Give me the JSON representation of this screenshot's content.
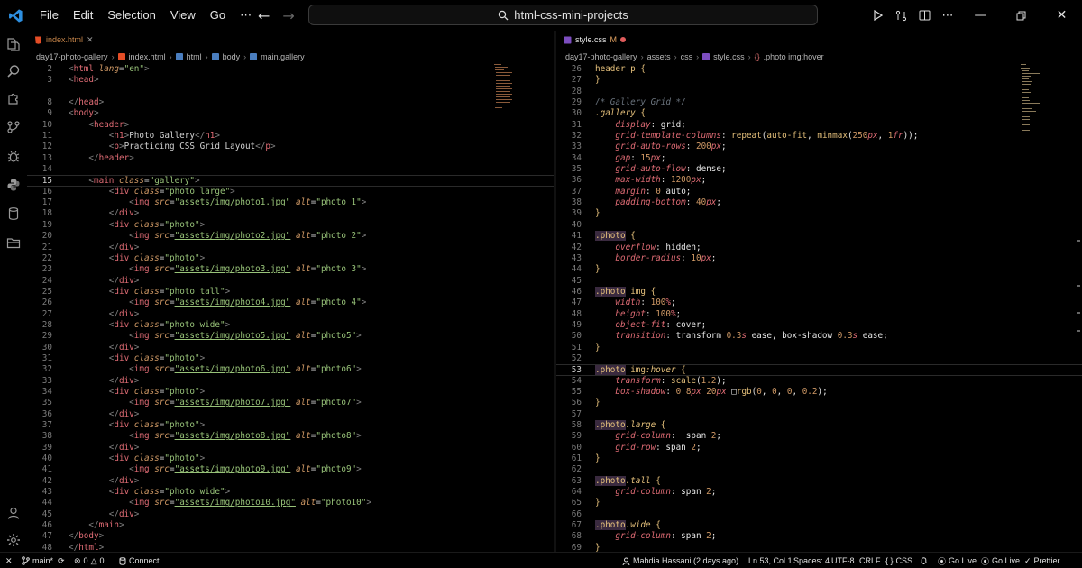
{
  "menu": [
    "File",
    "Edit",
    "Selection",
    "View",
    "Go"
  ],
  "titlebar": {
    "search": "html-css-mini-projects"
  },
  "left": {
    "tab": "index.html",
    "breadcrumb": [
      "day17-photo-gallery",
      "index.html",
      "html",
      "body",
      "main.gallery"
    ],
    "lines": [
      {
        "n": "2",
        "t": "<html lang=\"en\">"
      },
      {
        "n": "3",
        "t": "<head>"
      },
      {
        "n": "",
        "t": "    "
      },
      {
        "n": "8",
        "t": "</head>"
      },
      {
        "n": "9",
        "t": "<body>"
      },
      {
        "n": "10",
        "t": "    <header>"
      },
      {
        "n": "11",
        "t": "        <h1>Photo Gallery</h1>"
      },
      {
        "n": "12",
        "t": "        <p>Practicing CSS Grid Layout</p>"
      },
      {
        "n": "13",
        "t": "    </header>"
      },
      {
        "n": "14",
        "t": ""
      },
      {
        "n": "15",
        "t": "    <main class=\"gallery\">"
      },
      {
        "n": "16",
        "t": "        <div class=\"photo large\">"
      },
      {
        "n": "17",
        "t": "            <img src=\"assets/img/photo1.jpg\" alt=\"photo 1\">"
      },
      {
        "n": "18",
        "t": "        </div>"
      },
      {
        "n": "19",
        "t": "        <div class=\"photo\">"
      },
      {
        "n": "20",
        "t": "            <img src=\"assets/img/photo2.jpg\" alt=\"photo 2\">"
      },
      {
        "n": "21",
        "t": "        </div>"
      },
      {
        "n": "22",
        "t": "        <div class=\"photo\">"
      },
      {
        "n": "23",
        "t": "            <img src=\"assets/img/photo3.jpg\" alt=\"photo 3\">"
      },
      {
        "n": "24",
        "t": "        </div>"
      },
      {
        "n": "25",
        "t": "        <div class=\"photo tall\">"
      },
      {
        "n": "26",
        "t": "            <img src=\"assets/img/photo4.jpg\" alt=\"photo 4\">"
      },
      {
        "n": "27",
        "t": "        </div>"
      },
      {
        "n": "28",
        "t": "        <div class=\"photo wide\">"
      },
      {
        "n": "29",
        "t": "            <img src=\"assets/img/photo5.jpg\" alt=\"photo5\">"
      },
      {
        "n": "30",
        "t": "        </div>"
      },
      {
        "n": "31",
        "t": "        <div class=\"photo\">"
      },
      {
        "n": "32",
        "t": "            <img src=\"assets/img/photo6.jpg\" alt=\"photo6\">"
      },
      {
        "n": "33",
        "t": "        </div>"
      },
      {
        "n": "34",
        "t": "        <div class=\"photo\">"
      },
      {
        "n": "35",
        "t": "            <img src=\"assets/img/photo7.jpg\" alt=\"photo7\">"
      },
      {
        "n": "36",
        "t": "        </div>"
      },
      {
        "n": "37",
        "t": "        <div class=\"photo\">"
      },
      {
        "n": "38",
        "t": "            <img src=\"assets/img/photo8.jpg\" alt=\"photo8\">"
      },
      {
        "n": "39",
        "t": "        </div>"
      },
      {
        "n": "40",
        "t": "        <div class=\"photo\">"
      },
      {
        "n": "41",
        "t": "            <img src=\"assets/img/photo9.jpg\" alt=\"photo9\">"
      },
      {
        "n": "42",
        "t": "        </div>"
      },
      {
        "n": "43",
        "t": "        <div class=\"photo wide\">"
      },
      {
        "n": "44",
        "t": "            <img src=\"assets/img/photo10.jpg\" alt=\"photo10\">"
      },
      {
        "n": "45",
        "t": "        </div>"
      },
      {
        "n": "46",
        "t": "    </main>"
      },
      {
        "n": "47",
        "t": "</body>"
      },
      {
        "n": "48",
        "t": "</html>"
      }
    ]
  },
  "right": {
    "tab": "style.css",
    "tab_status": "M",
    "breadcrumb": [
      "day17-photo-gallery",
      "assets",
      "css",
      "style.css",
      ".photo img:hover"
    ],
    "lines": [
      {
        "n": "26",
        "t": "header p {"
      },
      {
        "n": "27",
        "t": "}"
      },
      {
        "n": "28",
        "t": ""
      },
      {
        "n": "29",
        "t": "/* Gallery Grid */"
      },
      {
        "n": "30",
        "t": ".gallery {"
      },
      {
        "n": "31",
        "t": "    display: grid;"
      },
      {
        "n": "32",
        "t": "    grid-template-columns: repeat(auto-fit, minmax(250px, 1fr));"
      },
      {
        "n": "33",
        "t": "    grid-auto-rows: 200px;"
      },
      {
        "n": "34",
        "t": "    gap: 15px;"
      },
      {
        "n": "35",
        "t": "    grid-auto-flow: dense;"
      },
      {
        "n": "36",
        "t": "    max-width: 1200px;"
      },
      {
        "n": "37",
        "t": "    margin: 0 auto;"
      },
      {
        "n": "38",
        "t": "    padding-bottom: 40px;"
      },
      {
        "n": "39",
        "t": "}"
      },
      {
        "n": "40",
        "t": ""
      },
      {
        "n": "41",
        "t": ".photo {"
      },
      {
        "n": "42",
        "t": "    overflow: hidden;"
      },
      {
        "n": "43",
        "t": "    border-radius: 10px;"
      },
      {
        "n": "44",
        "t": "}"
      },
      {
        "n": "45",
        "t": ""
      },
      {
        "n": "46",
        "t": ".photo img {"
      },
      {
        "n": "47",
        "t": "    width: 100%;"
      },
      {
        "n": "48",
        "t": "    height: 100%;"
      },
      {
        "n": "49",
        "t": "    object-fit: cover;"
      },
      {
        "n": "50",
        "t": "    transition: transform 0.3s ease, box-shadow 0.3s ease;"
      },
      {
        "n": "51",
        "t": "}"
      },
      {
        "n": "52",
        "t": ""
      },
      {
        "n": "53",
        "t": ".photo img:hover {"
      },
      {
        "n": "54",
        "t": "    transform: scale(1.2);"
      },
      {
        "n": "55",
        "t": "    box-shadow: 0 8px 20px □rgb(0, 0, 0, 0.2);"
      },
      {
        "n": "56",
        "t": "}"
      },
      {
        "n": "57",
        "t": ""
      },
      {
        "n": "58",
        "t": ".photo.large {"
      },
      {
        "n": "59",
        "t": "    grid-column:  span 2;"
      },
      {
        "n": "60",
        "t": "    grid-row: span 2;"
      },
      {
        "n": "61",
        "t": "}"
      },
      {
        "n": "62",
        "t": ""
      },
      {
        "n": "63",
        "t": ".photo.tall {"
      },
      {
        "n": "64",
        "t": "    grid-column: span 2;"
      },
      {
        "n": "65",
        "t": "}"
      },
      {
        "n": "66",
        "t": ""
      },
      {
        "n": "67",
        "t": ".photo.wide {"
      },
      {
        "n": "68",
        "t": "    grid-column: span 2;"
      },
      {
        "n": "69",
        "t": "}"
      }
    ]
  },
  "status": {
    "branch": "main*",
    "problems": "0",
    "warnings": "0",
    "connect": "Connect",
    "blame": "Mahdia Hassani (2 days ago)",
    "position": "Ln 53, Col 1",
    "spaces": "Spaces: 4",
    "encoding": "UTF-8",
    "eol": "CRLF",
    "language": "CSS",
    "golive1": "Go Live",
    "golive2": "Go Live",
    "prettier": "Prettier"
  }
}
